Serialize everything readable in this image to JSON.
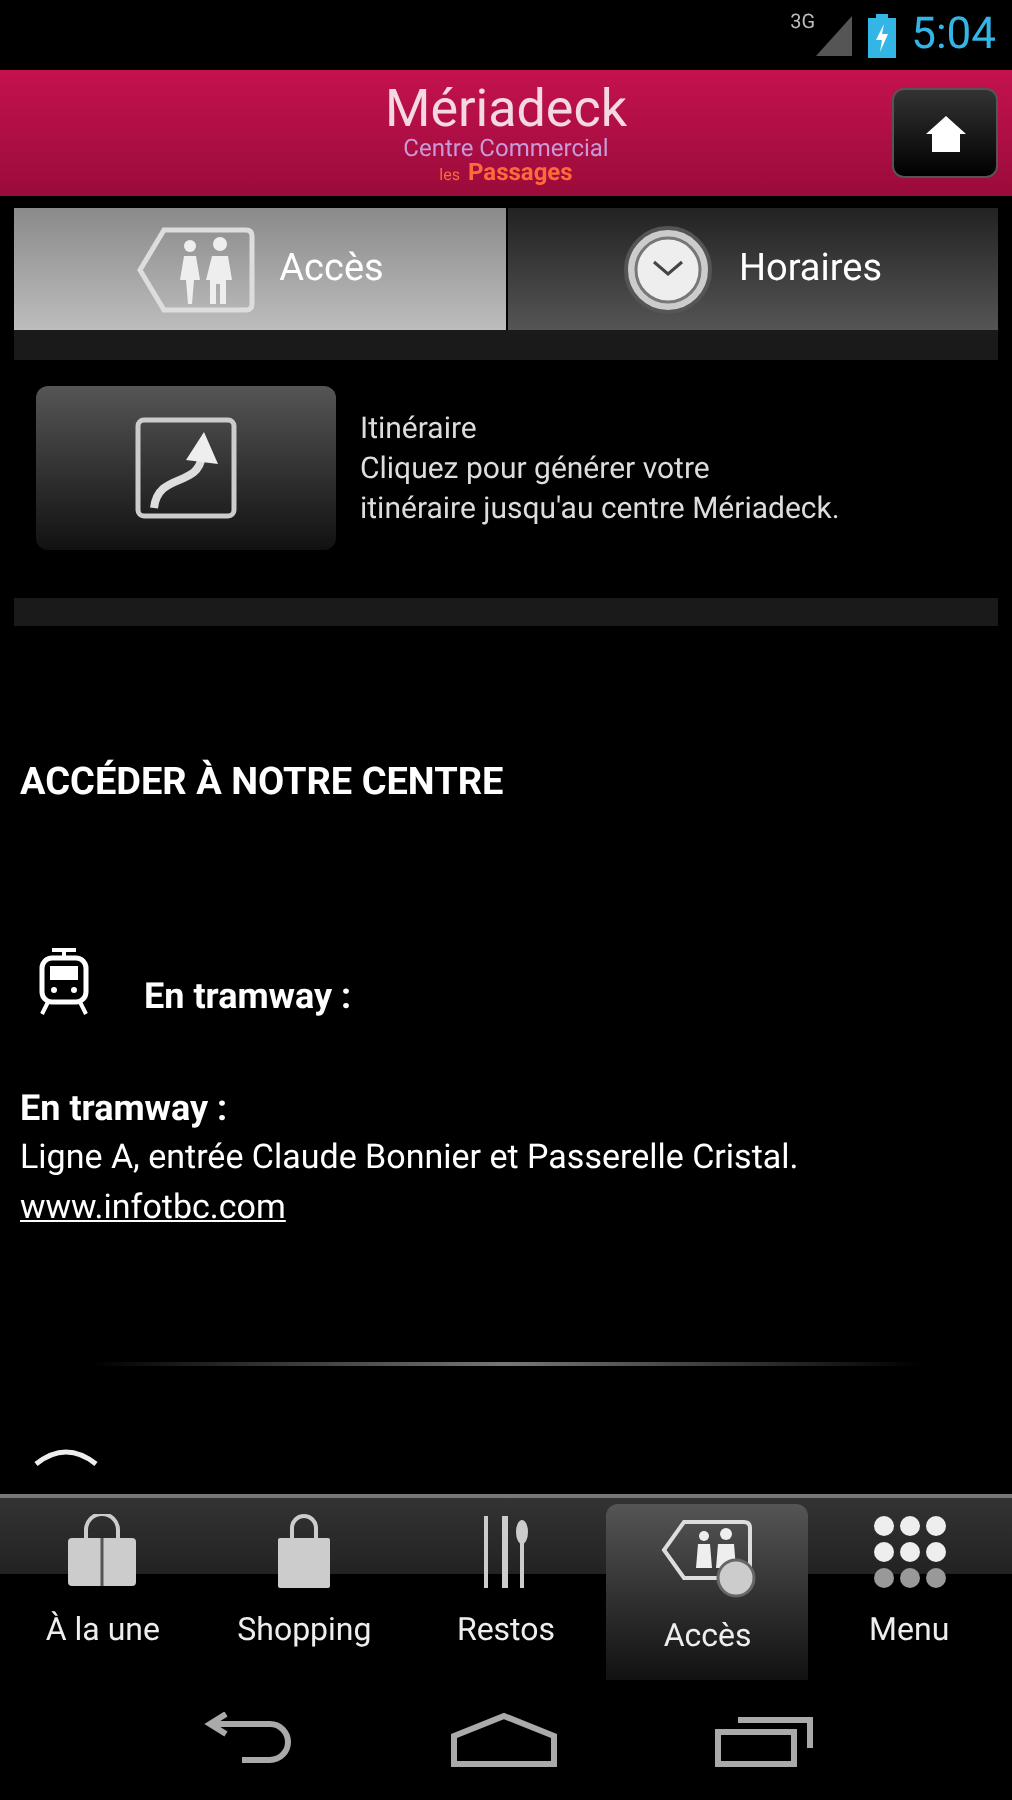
{
  "status_bar": {
    "network": "3G",
    "time": "5:04"
  },
  "header": {
    "logo_title": "Mériadeck",
    "logo_subtitle": "Centre Commercial",
    "logo_prefix": "les",
    "logo_name": "Passages"
  },
  "tabs": [
    {
      "label": "Accès",
      "selected": true
    },
    {
      "label": "Horaires",
      "selected": false
    }
  ],
  "itinerary": {
    "title": "Itinéraire",
    "text_line_1": "Cliquez pour générer votre",
    "text_line_2": "itinéraire jusqu'au centre Mériadeck."
  },
  "section": {
    "heading": "ACCÉDER À NOTRE CENTRE",
    "transport_label": "En tramway :",
    "subheading": "En tramway :",
    "description": "Ligne A, entrée Claude Bonnier et Passerelle Cristal.",
    "link": "www.infotbc.com"
  },
  "bottom_tabs": [
    {
      "label": "À la une",
      "selected": false
    },
    {
      "label": "Shopping",
      "selected": false
    },
    {
      "label": "Restos",
      "selected": false
    },
    {
      "label": "Accès",
      "selected": true
    },
    {
      "label": "Menu",
      "selected": false
    }
  ]
}
